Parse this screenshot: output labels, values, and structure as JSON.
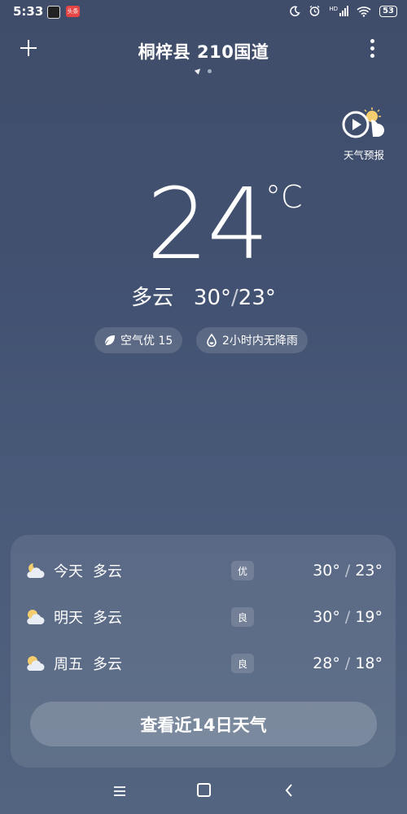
{
  "status_bar": {
    "time": "5:33",
    "app_badge": "头条",
    "battery": "53",
    "network": "HD"
  },
  "header": {
    "location": "桐梓县 210国道",
    "add_icon": "plus-icon",
    "more_icon": "more-vertical-icon"
  },
  "forecast_video": {
    "label": "天气预报",
    "icon": "play-cloud-icon"
  },
  "current": {
    "temperature": "24",
    "unit": "°C",
    "condition": "多云",
    "high": "30°",
    "low": "23°",
    "slash": "/"
  },
  "chips": {
    "air": "空气优 15",
    "rain": "2小时内无降雨"
  },
  "daily": [
    {
      "day": "今天",
      "condition": "多云",
      "aqi": "优",
      "high": "30°",
      "low": "23°"
    },
    {
      "day": "明天",
      "condition": "多云",
      "aqi": "良",
      "high": "30°",
      "low": "19°"
    },
    {
      "day": "周五",
      "condition": "多云",
      "aqi": "良",
      "high": "28°",
      "low": "18°"
    }
  ],
  "range_slash": "/",
  "view_14_days": "查看近14日天气",
  "nav": {
    "menu": "≡",
    "back": "‹"
  },
  "colors": {
    "background_top": "#3f4d6a",
    "background_bottom": "#52647f",
    "sun": "#f4cd6e"
  }
}
